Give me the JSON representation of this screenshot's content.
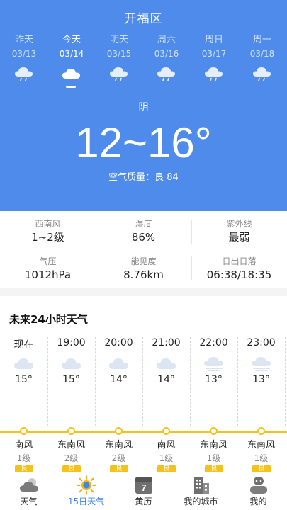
{
  "header": {
    "city": "开福区",
    "days": [
      {
        "name": "昨天",
        "date": "03/13",
        "icon": "cloud-rain-icon",
        "active": false
      },
      {
        "name": "今天",
        "date": "03/14",
        "icon": "cloud-icon",
        "active": true
      },
      {
        "name": "明天",
        "date": "03/15",
        "icon": "cloud-rain-icon",
        "active": false
      },
      {
        "name": "周六",
        "date": "03/16",
        "icon": "cloud-rain-icon",
        "active": false
      },
      {
        "name": "周日",
        "date": "03/17",
        "icon": "cloud-rain-icon",
        "active": false
      },
      {
        "name": "周一",
        "date": "03/18",
        "icon": "cloud-rain-icon",
        "active": false
      }
    ],
    "condition": "阴",
    "temperature": "12~16°",
    "aqi": "空气质量：良 84"
  },
  "details": [
    {
      "label": "西南风",
      "value": "1~2级"
    },
    {
      "label": "湿度",
      "value": "86%"
    },
    {
      "label": "紫外线",
      "value": "最弱"
    },
    {
      "label": "气压",
      "value": "1012hPa"
    },
    {
      "label": "能见度",
      "value": "8.76km"
    },
    {
      "label": "日出日落",
      "value": "06:38/18:35"
    }
  ],
  "hourly": {
    "title": "未来24小时天气",
    "items": [
      {
        "time": "现在",
        "icon": "cloud-icon",
        "temp": "15°",
        "wind": "南风",
        "level": "1级",
        "aqi": "良"
      },
      {
        "time": "19:00",
        "icon": "cloud-icon",
        "temp": "15°",
        "wind": "东南风",
        "level": "2级",
        "aqi": "良"
      },
      {
        "time": "20:00",
        "icon": "cloud-icon",
        "temp": "14°",
        "wind": "东南风",
        "level": "2级",
        "aqi": "良"
      },
      {
        "time": "21:00",
        "icon": "cloud-icon",
        "temp": "14°",
        "wind": "南风",
        "level": "1级",
        "aqi": "良"
      },
      {
        "time": "22:00",
        "icon": "cloud-fog-icon",
        "temp": "13°",
        "wind": "东南风",
        "level": "1级",
        "aqi": "良"
      },
      {
        "time": "23:00",
        "icon": "cloud-fog-icon",
        "temp": "13°",
        "wind": "东南风",
        "level": "1级",
        "aqi": "良"
      }
    ]
  },
  "nav": [
    {
      "label": "天气",
      "icon": "weather-icon",
      "active": false
    },
    {
      "label": "15日天气",
      "icon": "sun-icon",
      "active": true
    },
    {
      "label": "黄历",
      "icon": "calendar-icon",
      "calendar_day": "7",
      "active": false
    },
    {
      "label": "我的城市",
      "icon": "city-icon",
      "active": false
    },
    {
      "label": "我的",
      "icon": "profile-icon",
      "active": false
    }
  ],
  "colors": {
    "header_bg": "#4f8bea",
    "accent": "#3d86e6",
    "aqi_good": "#f5c11c"
  }
}
